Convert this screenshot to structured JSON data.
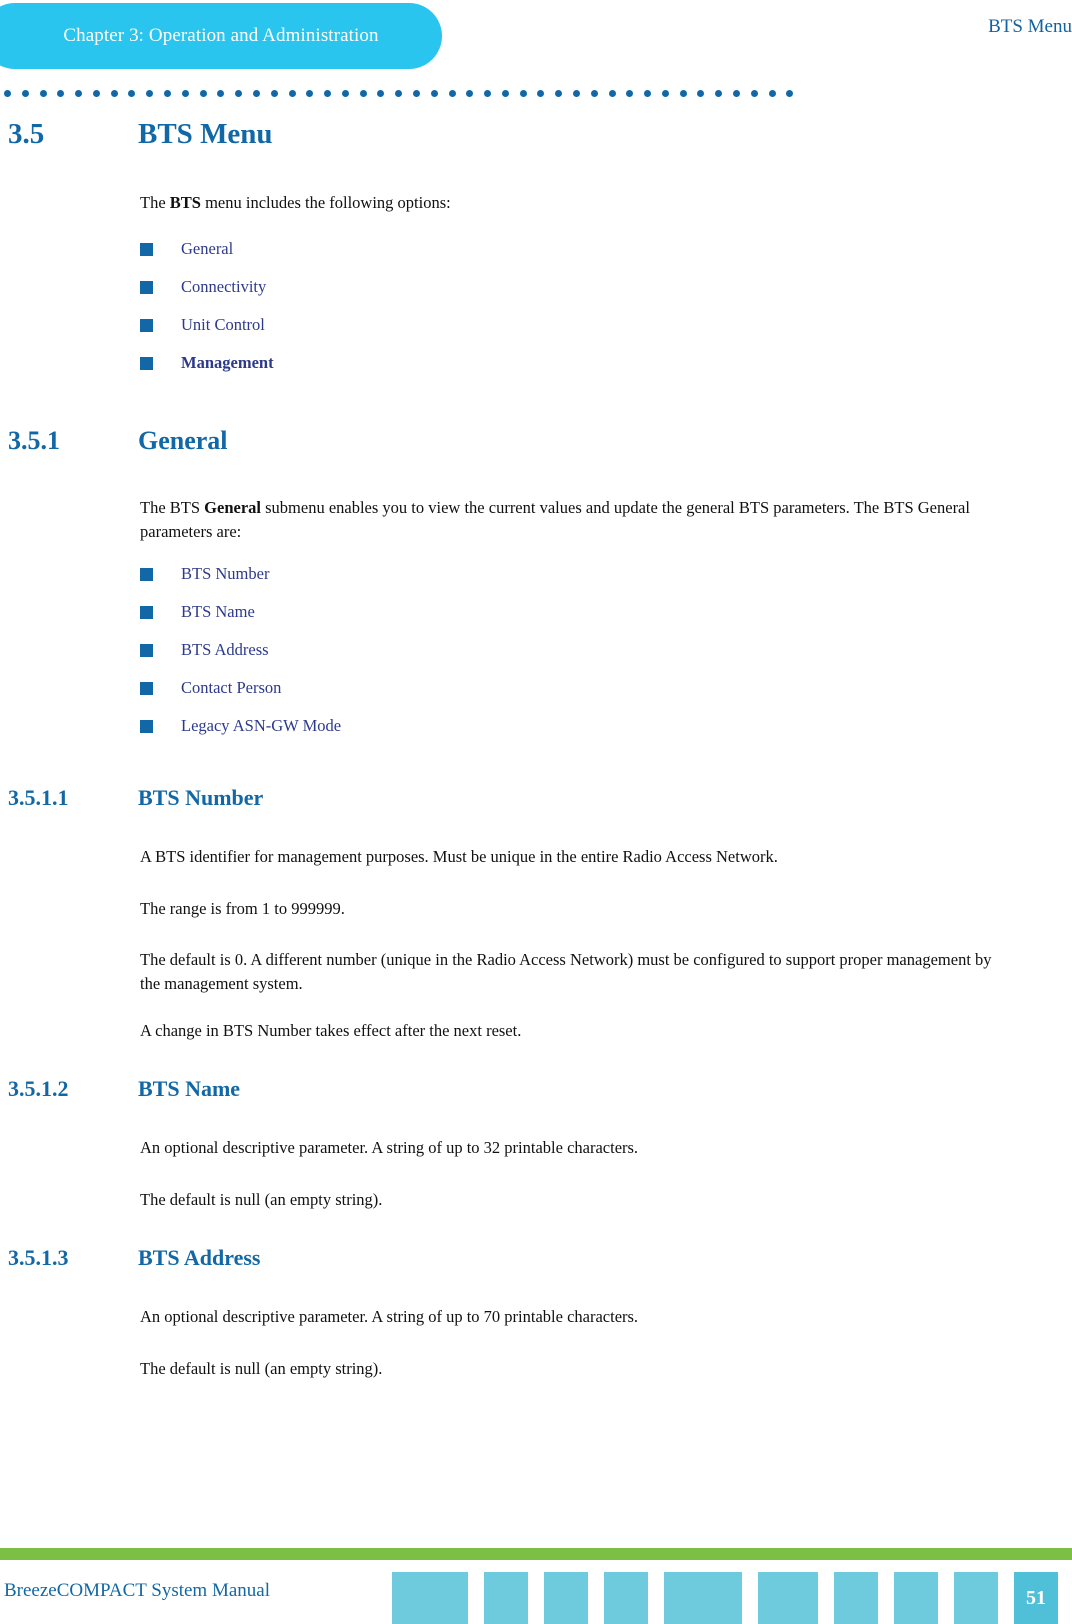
{
  "header": {
    "chapter_tab": "Chapter 3: Operation and Administration",
    "running_head": "BTS Menu",
    "tab_color": "#29c5ef",
    "rule_dot_color": "#1268a6"
  },
  "sections": {
    "s35": {
      "number": "3.5",
      "title": "BTS Menu",
      "intro_pre": "The ",
      "intro_bold": "BTS",
      "intro_post": " menu includes the following options:",
      "options": [
        {
          "label": "General",
          "bold": false
        },
        {
          "label": "Connectivity",
          "bold": false
        },
        {
          "label": "Unit Control",
          "bold": false
        },
        {
          "label": "Management",
          "bold": true
        }
      ]
    },
    "s351": {
      "number": "3.5.1",
      "title": "General",
      "intro_pre": "The BTS ",
      "intro_bold": "General",
      "intro_post": " submenu enables you to view the current values and update the general BTS parameters. The BTS General parameters are:",
      "parameters": [
        {
          "label": "BTS Number"
        },
        {
          "label": "BTS Name"
        },
        {
          "label": "BTS Address"
        },
        {
          "label": "Contact Person"
        },
        {
          "label": "Legacy ASN-GW Mode"
        }
      ]
    },
    "s3511": {
      "number": "3.5.1.1",
      "title": "BTS Number",
      "p1": "A BTS identifier for management purposes. Must be unique in the entire Radio Access Network.",
      "p2": "The range is from 1 to 999999.",
      "p3": "The default is 0. A different number (unique in the Radio Access Network) must be configured to support proper management by the management system.",
      "p4": "A change in BTS Number takes effect after the next reset."
    },
    "s3512": {
      "number": "3.5.1.2",
      "title": "BTS Name",
      "p1": "An optional descriptive parameter. A string of up to 32 printable characters.",
      "p2": "The default is null (an empty string)."
    },
    "s3513": {
      "number": "3.5.1.3",
      "title": "BTS Address",
      "p1": "An optional descriptive parameter. A string of up to 70 printable characters.",
      "p2": "The default is null (an empty string)."
    }
  },
  "footer": {
    "manual_title": "BreezeCOMPACT System Manual",
    "page_number": "51",
    "green_bar_color": "#7cbf45",
    "block_color": "#6dcbdd",
    "page_box_color": "#4fc0d8",
    "block_widths": [
      76,
      44,
      44,
      44,
      78,
      60,
      44,
      44,
      44,
      44
    ]
  }
}
